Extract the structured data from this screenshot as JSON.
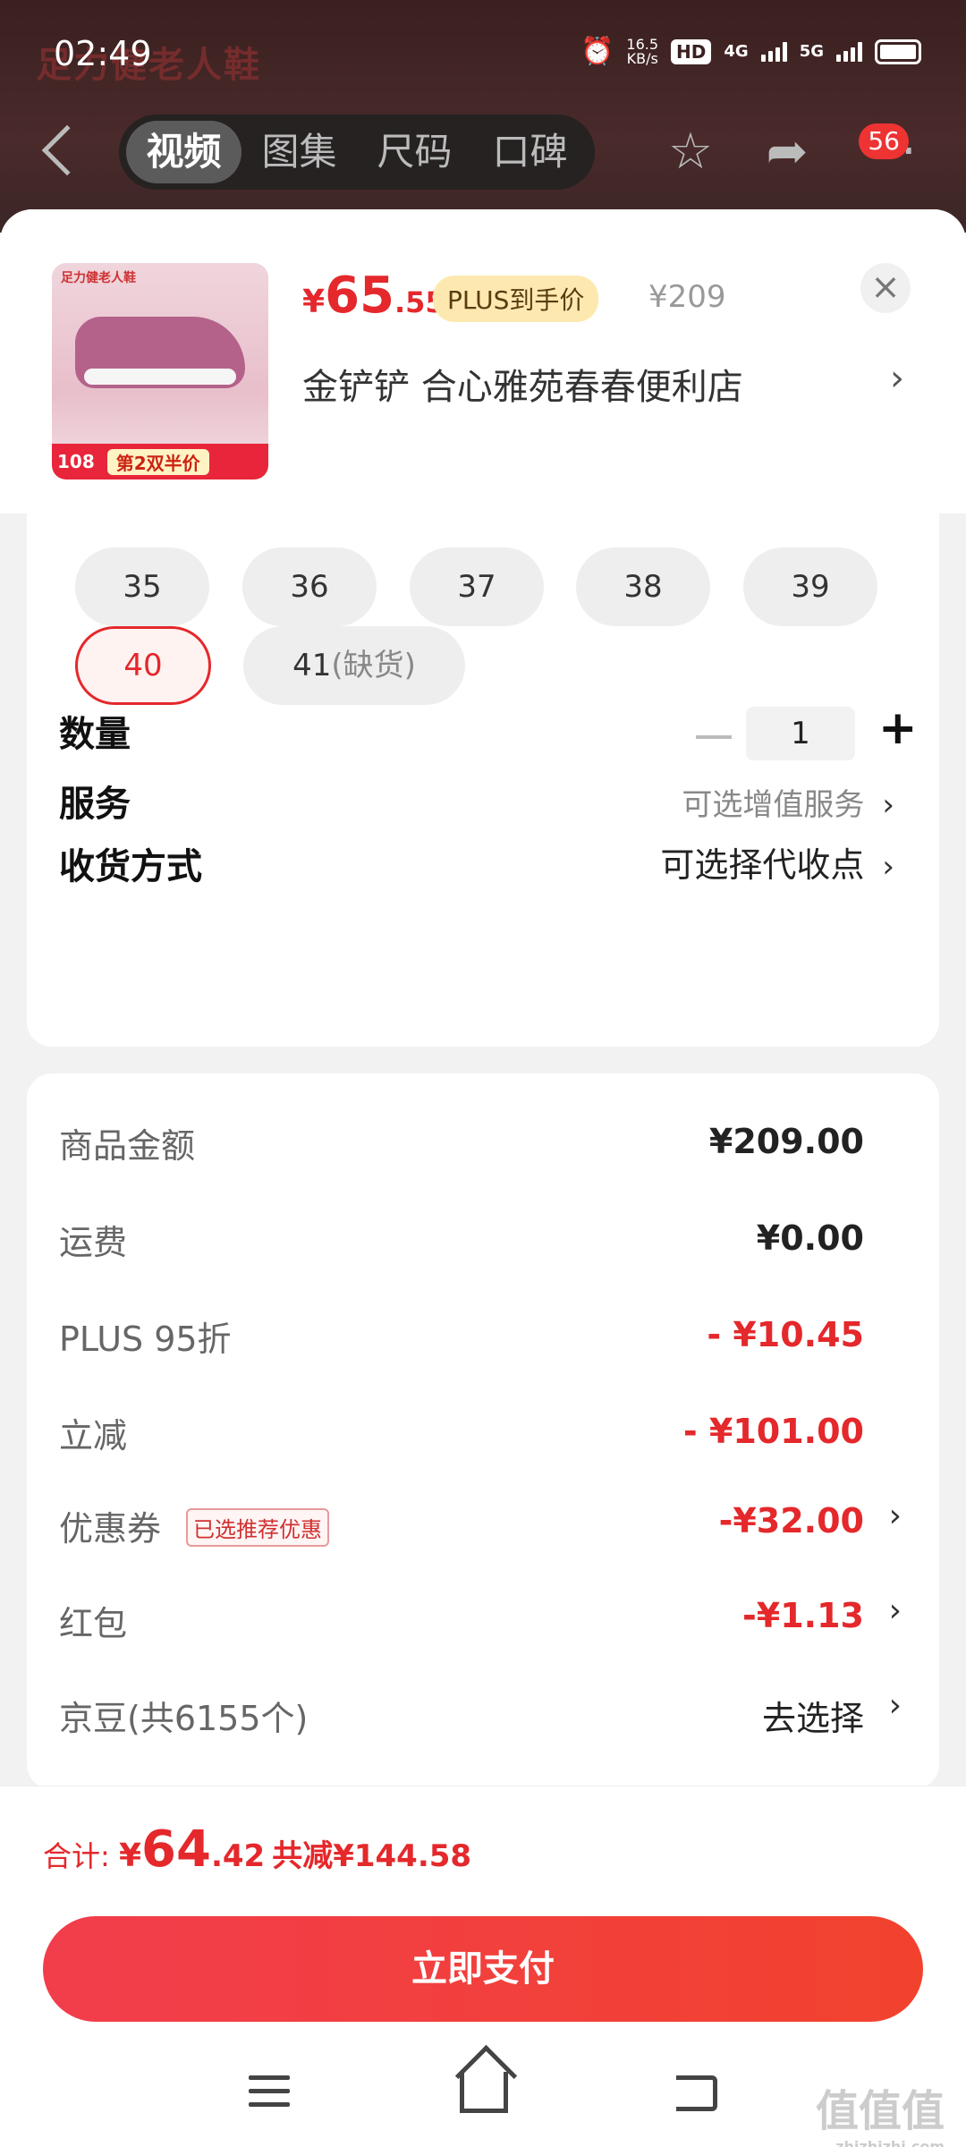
{
  "status_bar": {
    "time": "02:49",
    "net_speed": "16.5",
    "net_unit": "KB/s",
    "hd": "HD",
    "net1": "4G",
    "net2": "5G"
  },
  "background": {
    "brand": "足力健老人鞋"
  },
  "nav": {
    "tabs": [
      "视频",
      "图集",
      "尺码",
      "口碑"
    ],
    "badge": "56"
  },
  "product": {
    "thumb_logo": "足力健老人鞋",
    "thumb_strip_num": "108",
    "thumb_strip_half": "第2双半价",
    "price_currency": "¥",
    "price_int": "65",
    "price_dec": ".55",
    "plus_tag": "PLUS到手价",
    "original_price": "¥209",
    "shop": "金铲铲  合心雅苑春春便利店"
  },
  "sizes": [
    "35",
    "36",
    "37",
    "38",
    "39",
    "40",
    "41"
  ],
  "size_oos": "(缺货)",
  "quantity": {
    "label": "数量",
    "value": "1"
  },
  "service": {
    "label": "服务",
    "value": "可选增值服务"
  },
  "delivery": {
    "label": "收货方式",
    "value": "可选择代收点"
  },
  "fees": {
    "goods_label": "商品金额",
    "goods_value": "¥209.00",
    "shipping_label": "运费",
    "shipping_value": "¥0.00",
    "plus_label": "PLUS 95折",
    "plus_value": "- ¥10.45",
    "instant_label": "立减",
    "instant_value": "- ¥101.00",
    "coupon_label": "优惠券",
    "coupon_tag": "已选推荐优惠",
    "coupon_value": "-¥32.00",
    "redpack_label": "红包",
    "redpack_value": "-¥1.13",
    "jingdou_label": "京豆(共6155个)",
    "jingdou_value": "去选择"
  },
  "footer": {
    "total_label": "合计: ",
    "total_currency": "¥",
    "total_int": "64",
    "total_dec": ".42",
    "saved": "共减¥144.58",
    "pay_button": "立即支付"
  },
  "watermark": {
    "main": "值值值",
    "sub": "zhizhizhi.com"
  },
  "colors": {
    "accent": "#e4282b",
    "plus_tag_bg": "#fde9b0"
  }
}
